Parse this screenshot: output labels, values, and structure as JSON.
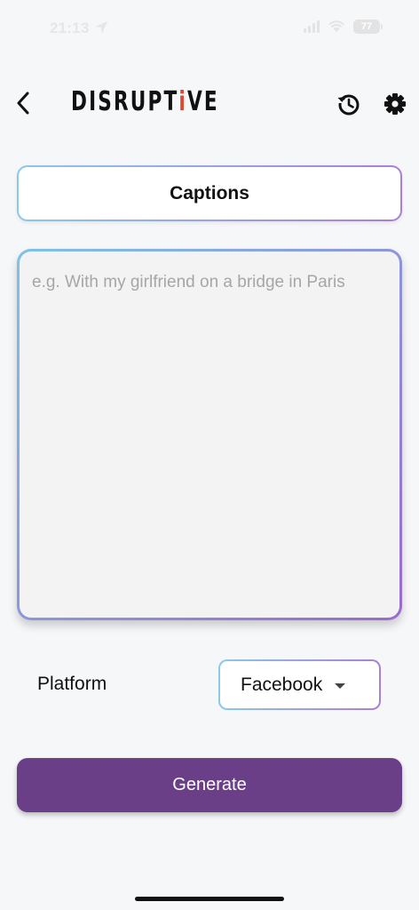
{
  "status_bar": {
    "time": "21:13",
    "battery": "77",
    "icons": [
      "location-arrow-icon",
      "signal-icon",
      "wifi-icon",
      "battery-icon"
    ]
  },
  "header": {
    "logo_before": "DISRUPT",
    "logo_accent": "i",
    "logo_after": "VE",
    "icons": [
      "chevron-left-icon",
      "history-icon",
      "gear-icon"
    ]
  },
  "tab": {
    "label": "Captions"
  },
  "prompt": {
    "placeholder": "e.g. With my girlfriend on a bridge in Paris",
    "value": ""
  },
  "platform": {
    "label": "Platform",
    "selected": "Facebook"
  },
  "actions": {
    "generate_label": "Generate"
  },
  "colors": {
    "background": "#f6f7f9",
    "primary": "#6a3f87",
    "gradient_start": "#8cc8e8",
    "gradient_end": "#a97fd8",
    "logo_accent": "#e2462f"
  }
}
